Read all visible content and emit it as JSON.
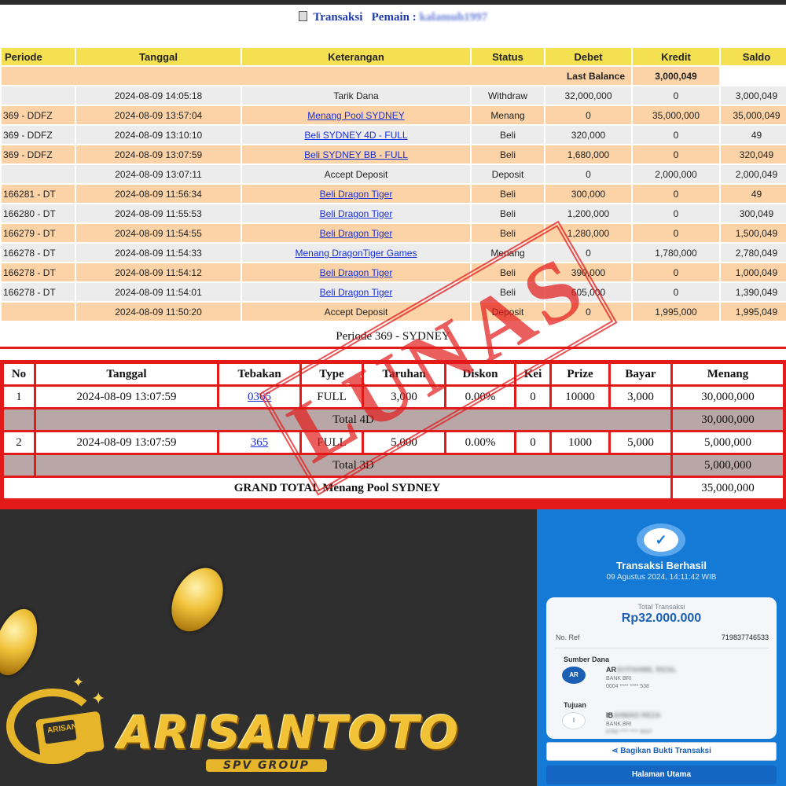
{
  "header": {
    "title": "Transaksi",
    "player_label": "Pemain :",
    "player_name": "kalamuh1997"
  },
  "table": {
    "columns": [
      "Periode",
      "Tanggal",
      "Keterangan",
      "Status",
      "Debet",
      "Kredit",
      "Saldo"
    ],
    "last_balance_label": "Last Balance",
    "last_balance_value": "3,000,049",
    "rows": [
      {
        "periode": "",
        "tanggal": "2024-08-09 14:05:18",
        "keterangan": "Tarik Dana",
        "keterangan_link": false,
        "status": "Withdraw",
        "debet": "32,000,000",
        "kredit": "0",
        "saldo": "3,000,049"
      },
      {
        "periode": "369 - DDFZ",
        "tanggal": "2024-08-09 13:57:04",
        "keterangan": "Menang Pool SYDNEY",
        "keterangan_link": true,
        "status": "Menang",
        "debet": "0",
        "kredit": "35,000,000",
        "saldo": "35,000,049"
      },
      {
        "periode": "369 - DDFZ",
        "tanggal": "2024-08-09 13:10:10",
        "keterangan": "Beli SYDNEY 4D - FULL",
        "keterangan_link": true,
        "status": "Beli",
        "debet": "320,000",
        "kredit": "0",
        "saldo": "49"
      },
      {
        "periode": "369 - DDFZ",
        "tanggal": "2024-08-09 13:07:59",
        "keterangan": "Beli SYDNEY BB - FULL",
        "keterangan_link": true,
        "status": "Beli",
        "debet": "1,680,000",
        "kredit": "0",
        "saldo": "320,049"
      },
      {
        "periode": "",
        "tanggal": "2024-08-09 13:07:11",
        "keterangan": "Accept Deposit",
        "keterangan_link": false,
        "status": "Deposit",
        "debet": "0",
        "kredit": "2,000,000",
        "saldo": "2,000,049"
      },
      {
        "periode": "166281 - DT",
        "tanggal": "2024-08-09 11:56:34",
        "keterangan": "Beli Dragon Tiger",
        "keterangan_link": true,
        "status": "Beli",
        "debet": "300,000",
        "kredit": "0",
        "saldo": "49"
      },
      {
        "periode": "166280 - DT",
        "tanggal": "2024-08-09 11:55:53",
        "keterangan": "Beli Dragon Tiger",
        "keterangan_link": true,
        "status": "Beli",
        "debet": "1,200,000",
        "kredit": "0",
        "saldo": "300,049"
      },
      {
        "periode": "166279 - DT",
        "tanggal": "2024-08-09 11:54:55",
        "keterangan": "Beli Dragon Tiger",
        "keterangan_link": true,
        "status": "Beli",
        "debet": "1,280,000",
        "kredit": "0",
        "saldo": "1,500,049"
      },
      {
        "periode": "166278 - DT",
        "tanggal": "2024-08-09 11:54:33",
        "keterangan": "Menang DragonTiger Games",
        "keterangan_link": true,
        "status": "Menang",
        "debet": "0",
        "kredit": "1,780,000",
        "saldo": "2,780,049"
      },
      {
        "periode": "166278 - DT",
        "tanggal": "2024-08-09 11:54:12",
        "keterangan": "Beli Dragon Tiger",
        "keterangan_link": true,
        "status": "Beli",
        "debet": "390,000",
        "kredit": "0",
        "saldo": "1,000,049"
      },
      {
        "periode": "166278 - DT",
        "tanggal": "2024-08-09 11:54:01",
        "keterangan": "Beli Dragon Tiger",
        "keterangan_link": true,
        "status": "Beli",
        "debet": "605,000",
        "kredit": "0",
        "saldo": "1,390,049"
      },
      {
        "periode": "",
        "tanggal": "2024-08-09 11:50:20",
        "keterangan": "Accept Deposit",
        "keterangan_link": false,
        "status": "Deposit",
        "debet": "0",
        "kredit": "1,995,000",
        "saldo": "1,995,049"
      }
    ]
  },
  "detail": {
    "title": "Periode 369 - SYDNEY",
    "columns": [
      "No",
      "Tanggal",
      "Tebakan",
      "Type",
      "Taruhan",
      "Diskon",
      "Kei",
      "Prize",
      "Bayar",
      "Menang"
    ],
    "bets": [
      {
        "no": "1",
        "tanggal": "2024-08-09 13:07:59",
        "tebakan": "0365",
        "type": "FULL",
        "taruhan": "3,000",
        "diskon": "0.00%",
        "kei": "0",
        "prize": "10000",
        "bayar": "3,000",
        "menang": "30,000,000"
      },
      {
        "no": "2",
        "tanggal": "2024-08-09 13:07:59",
        "tebakan": "365",
        "type": "FULL",
        "taruhan": "5,000",
        "diskon": "0.00%",
        "kei": "0",
        "prize": "1000",
        "bayar": "5,000",
        "menang": "5,000,000"
      }
    ],
    "totals": [
      {
        "label": "Total 4D",
        "value": "30,000,000"
      },
      {
        "label": "Total 3D",
        "value": "5,000,000"
      }
    ],
    "grand_total_label": "GRAND TOTAL  Menang Pool SYDNEY",
    "grand_total_value": "35,000,000"
  },
  "stamp": {
    "text": "LUNAS",
    "color": "#e21a1a"
  },
  "brand": {
    "name": "ARISANTOTO",
    "sub": "SPV GROUP",
    "emblem_text": "ARISAN"
  },
  "receipt": {
    "title": "Transaksi Berhasil",
    "date": "09 Agustus 2024, 14:11:42 WIB",
    "total_label": "Total Transaksi",
    "total_value": "Rp32.000.000",
    "ref_label": "No. Ref",
    "ref_value": "719837746533",
    "source_label": "Sumber Dana",
    "source_avatar": "AR",
    "source_name_visible": "AR",
    "source_name_hidden": "ISYFAHMIL RIZAL",
    "source_bank": "BANK BRI",
    "source_account": "0004 **** **** 538",
    "dest_label": "Tujuan",
    "dest_avatar": "I",
    "dest_name_visible": "IB",
    "dest_name_hidden": "AHMAD REZA",
    "dest_bank": "BANK BRI",
    "dest_account": "5760 **** **** 5037",
    "share_button": "Bagikan Bukti Transaksi",
    "home_button": "Halaman Utama"
  },
  "colors": {
    "header_yellow": "#f5e052",
    "row_orange": "#fbd3a6",
    "row_grey": "#ececec",
    "link_blue": "#1a2fd8",
    "status_red": "#e0201e",
    "receipt_blue": "#1579d6",
    "brand_gold": "#f2c236"
  }
}
